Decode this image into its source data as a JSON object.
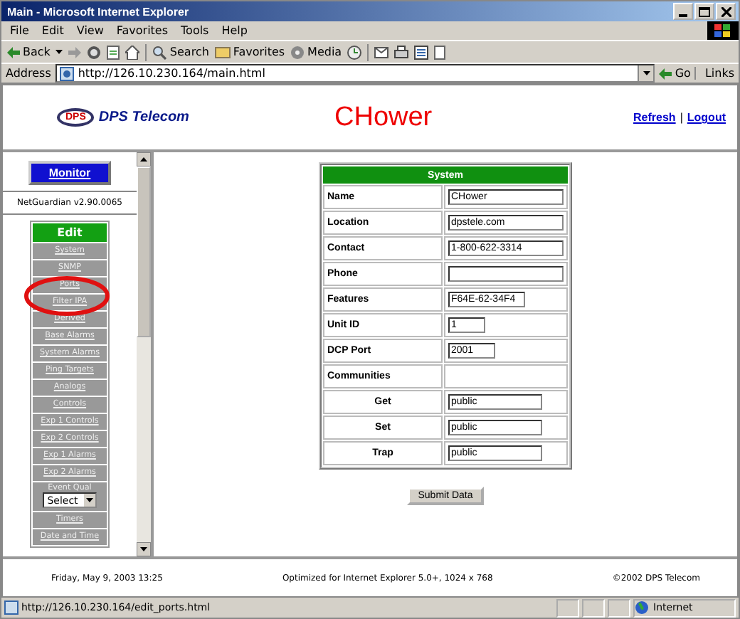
{
  "window": {
    "title": "Main - Microsoft Internet Explorer"
  },
  "menu": [
    "File",
    "Edit",
    "View",
    "Favorites",
    "Tools",
    "Help"
  ],
  "toolbar": {
    "back": "Back",
    "search": "Search",
    "favorites": "Favorites",
    "media": "Media"
  },
  "address": {
    "label": "Address",
    "url": "http://126.10.230.164/main.html",
    "go": "Go",
    "links": "Links"
  },
  "header": {
    "logo_badge": "DPS",
    "logo_text": "DPS Telecom",
    "title": "CHower",
    "links": [
      "Refresh",
      "Logout"
    ],
    "separator": "|"
  },
  "sidebar": {
    "monitor": "Monitor",
    "version": "NetGuardian v2.90.0065",
    "edit": "Edit",
    "items": [
      {
        "kind": "link",
        "label": "System"
      },
      {
        "kind": "link",
        "label": "SNMP"
      },
      {
        "kind": "link",
        "label": "Ports"
      },
      {
        "kind": "link",
        "label": "Filter IPA"
      },
      {
        "kind": "link",
        "label": "Derived"
      },
      {
        "kind": "link",
        "label": "Base Alarms"
      },
      {
        "kind": "link",
        "label": "System Alarms"
      },
      {
        "kind": "link",
        "label": "Ping Targets"
      },
      {
        "kind": "link",
        "label": "Analogs"
      },
      {
        "kind": "link",
        "label": "Controls"
      },
      {
        "kind": "link",
        "label": "Exp 1 Controls"
      },
      {
        "kind": "link",
        "label": "Exp 2 Controls"
      },
      {
        "kind": "link",
        "label": "Exp 1 Alarms"
      },
      {
        "kind": "link",
        "label": "Exp 2 Alarms"
      },
      {
        "kind": "select",
        "label": "Event Qual",
        "value": "Select"
      },
      {
        "kind": "link",
        "label": "Timers"
      },
      {
        "kind": "link",
        "label": "Date and Time"
      }
    ]
  },
  "form": {
    "title": "System",
    "rows": [
      {
        "kind": "wide",
        "label": "Name",
        "value": "CHower"
      },
      {
        "kind": "wide",
        "label": "Location",
        "value": "dpstele.com"
      },
      {
        "kind": "wide",
        "label": "Contact",
        "value": "1-800-622-3314"
      },
      {
        "kind": "wide",
        "label": "Phone",
        "value": ""
      },
      {
        "kind": "medium",
        "label": "Features",
        "value": "F64E-62-34F4"
      },
      {
        "kind": "tiny",
        "label": "Unit ID",
        "value": "1"
      },
      {
        "kind": "narrow",
        "label": "DCP Port",
        "value": "2001"
      },
      {
        "kind": "group",
        "label": "Communities"
      },
      {
        "kind": "sub",
        "label": "Get",
        "value": "public"
      },
      {
        "kind": "sub",
        "label": "Set",
        "value": "public"
      },
      {
        "kind": "sub",
        "label": "Trap",
        "value": "public"
      }
    ],
    "submit": "Submit Data"
  },
  "footer": {
    "date": "Friday, May 9, 2003  13:25",
    "optimized": "Optimized for Internet Explorer 5.0+, 1024 x 768",
    "copyright": "©2002 DPS Telecom"
  },
  "status_bar": {
    "url": "http://126.10.230.164/edit_ports.html",
    "zone": "Internet"
  }
}
